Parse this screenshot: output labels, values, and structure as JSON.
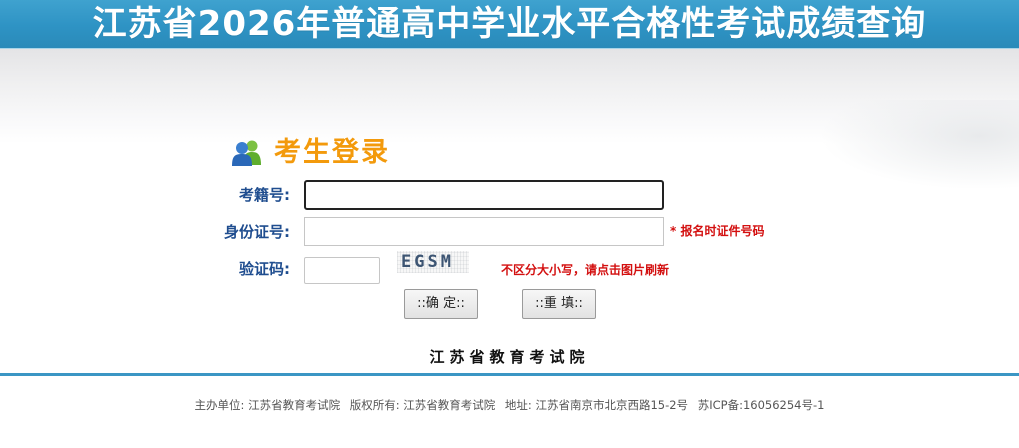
{
  "header": {
    "title": "江苏省2026年普通高中学业水平合格性考试成绩查询"
  },
  "login": {
    "icon": "users-icon",
    "title": "考生登录",
    "exam_id_label": "考籍号:",
    "exam_id_value": "",
    "id_card_label": "身份证号:",
    "id_card_value": "",
    "id_card_hint": "* 报名时证件号码",
    "captcha_label": "验证码:",
    "captcha_value": "",
    "captcha_image_text": "EGSM",
    "captcha_hint": "不区分大小写，请点击图片刷新",
    "confirm_button": "::确 定::",
    "reset_button": "::重 填::"
  },
  "organization": "江苏省教育考试院",
  "footer": {
    "host": "主办单位: 江苏省教育考试院",
    "copyright": "版权所有: 江苏省教育考试院",
    "address": "地址: 江苏省南京市北京西路15-2号",
    "icp": "苏ICP备:16056254号-1"
  },
  "colors": {
    "banner": "#2e93c4",
    "login_title": "#f39a0c",
    "label": "#1f4d8f",
    "hint": "#d30f0f",
    "divider": "#3b96c4"
  }
}
